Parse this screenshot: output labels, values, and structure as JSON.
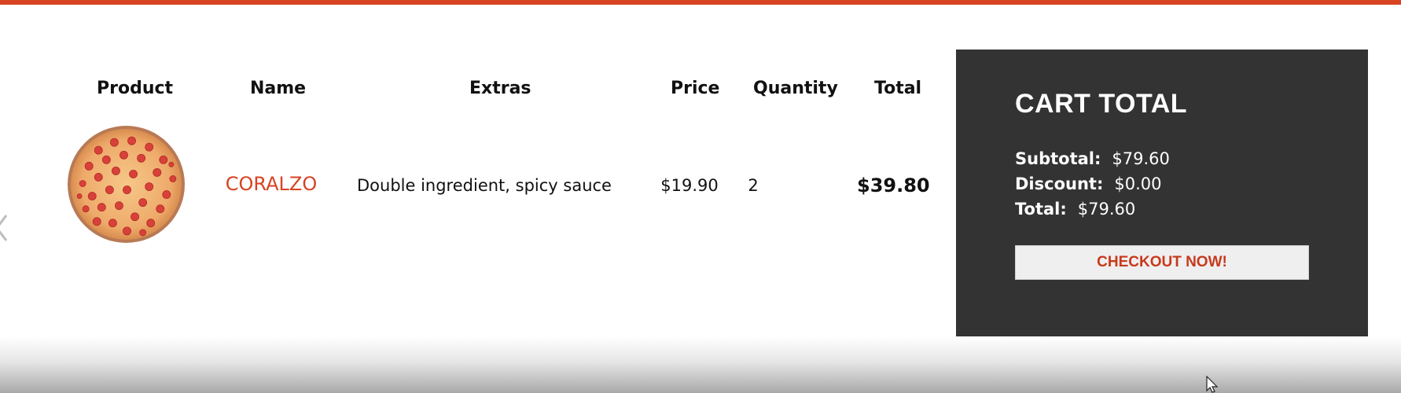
{
  "colors": {
    "accent": "#d84323",
    "panel_bg": "#333333",
    "checkout_text": "#c8391b"
  },
  "table": {
    "headers": {
      "product": "Product",
      "name": "Name",
      "extras": "Extras",
      "price": "Price",
      "quantity": "Quantity",
      "total": "Total"
    },
    "rows": [
      {
        "image": "pepperoni-pizza",
        "name": "CORALZO",
        "extras": "Double ingredient, spicy sauce",
        "price": "$19.90",
        "quantity": "2",
        "total": "$39.80"
      }
    ]
  },
  "cart": {
    "title": "CART TOTAL",
    "subtotal_label": "Subtotal:",
    "subtotal_value": "$79.60",
    "discount_label": "Discount:",
    "discount_value": "$0.00",
    "total_label": "Total:",
    "total_value": "$79.60",
    "checkout_label": "CHECKOUT NOW!"
  },
  "icons": {
    "left_nav": "chevron-left-icon",
    "cursor": "mouse-pointer-icon"
  }
}
